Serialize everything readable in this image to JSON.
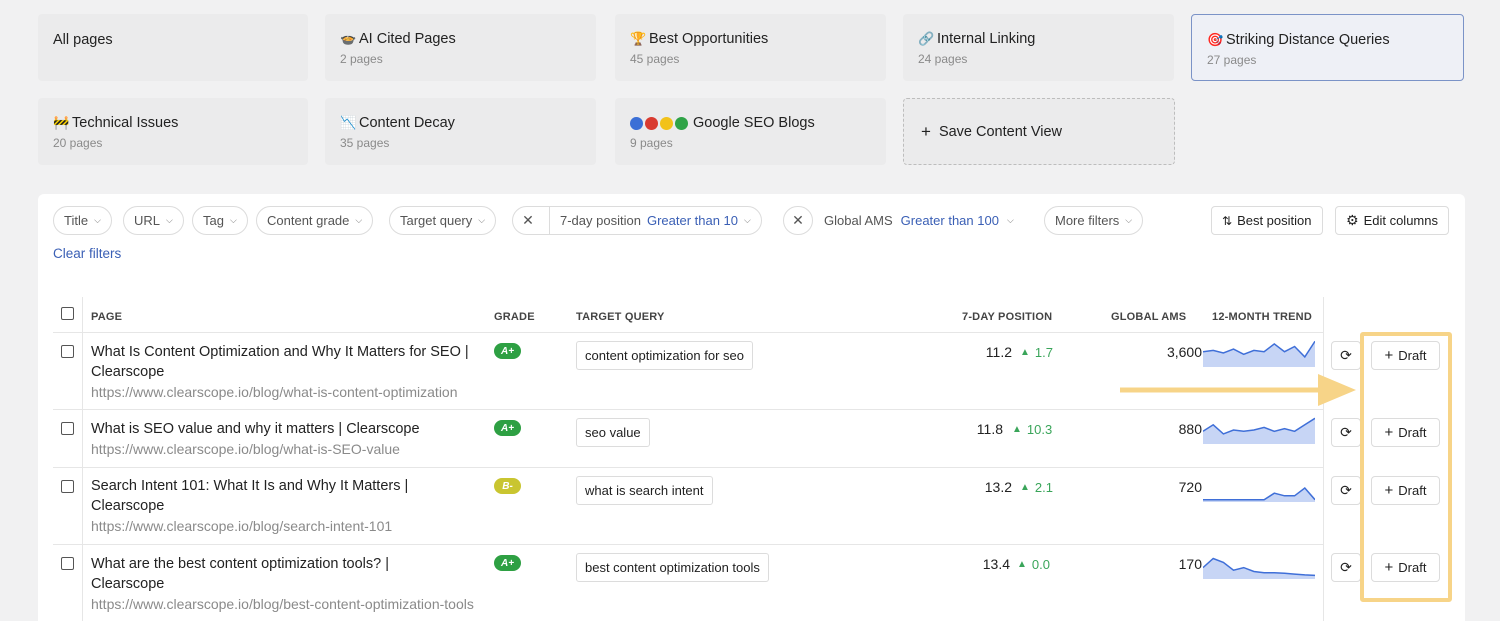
{
  "views": [
    {
      "name": "All pages",
      "count": "",
      "emoji": ""
    },
    {
      "name": "AI Cited Pages",
      "count": "2 pages",
      "emoji": "🍲"
    },
    {
      "name": "Best Opportunities",
      "count": "45 pages",
      "emoji": "🏆"
    },
    {
      "name": "Internal Linking",
      "count": "24 pages",
      "emoji": "🔗"
    },
    {
      "name": "Striking Distance Queries",
      "count": "27 pages",
      "emoji": "🎯"
    },
    {
      "name": "Technical Issues",
      "count": "20 pages",
      "emoji": "🚧"
    },
    {
      "name": "Content Decay",
      "count": "35 pages",
      "emoji": "📉"
    },
    {
      "name": "Google SEO Blogs",
      "count": "9 pages",
      "emoji": ""
    }
  ],
  "save_view_label": "Save Content View",
  "filters": {
    "title": "Title",
    "url": "URL",
    "tag": "Tag",
    "content_grade": "Content grade",
    "target_query": "Target query",
    "position_label": "7-day position",
    "position_value": "Greater than 10",
    "ams_label": "Global AMS",
    "ams_value": "Greater than 100",
    "more": "More filters",
    "clear": "Clear filters"
  },
  "actions": {
    "sort": "Best position",
    "edit_columns": "Edit columns"
  },
  "columns": {
    "page": "PAGE",
    "grade": "GRADE",
    "target_query": "TARGET QUERY",
    "position": "7-DAY POSITION",
    "ams": "GLOBAL AMS",
    "trend": "12-MONTH TREND"
  },
  "rows": [
    {
      "title": "What Is Content Optimization and Why It Matters for SEO | Clearscope",
      "url": "https://www.clearscope.io/blog/what-is-content-optimization",
      "grade": "A+",
      "grade_color": "#2ea043",
      "query": "content optimization for seo",
      "position": "11.2",
      "delta": "1.7",
      "ams": "3,600",
      "trend": [
        0.55,
        0.6,
        0.5,
        0.65,
        0.45,
        0.6,
        0.55,
        0.85,
        0.55,
        0.75,
        0.35,
        0.95
      ]
    },
    {
      "title": "What is SEO value and why it matters | Clearscope",
      "url": "https://www.clearscope.io/blog/what-is-SEO-value",
      "grade": "A+",
      "grade_color": "#2ea043",
      "query": "seo value",
      "position": "11.8",
      "delta": "10.3",
      "ams": "880",
      "trend": [
        0.45,
        0.7,
        0.35,
        0.5,
        0.45,
        0.5,
        0.6,
        0.45,
        0.55,
        0.45,
        0.7,
        0.95
      ]
    },
    {
      "title": "Search Intent 101: What It Is and Why It Matters | Clearscope",
      "url": "https://www.clearscope.io/blog/search-intent-101",
      "grade": "B-",
      "grade_color": "#c9c530",
      "query": "what is search intent",
      "position": "13.2",
      "delta": "2.1",
      "ams": "720",
      "trend": [
        0.05,
        0.05,
        0.05,
        0.05,
        0.05,
        0.05,
        0.05,
        0.3,
        0.2,
        0.2,
        0.5,
        0.05
      ]
    },
    {
      "title": "What are the best content optimization tools? | Clearscope",
      "url": "https://www.clearscope.io/blog/best-content-optimization-tools",
      "grade": "A+",
      "grade_color": "#2ea043",
      "query": "best content optimization tools",
      "position": "13.4",
      "delta": "0.0",
      "ams": "170",
      "trend": [
        0.4,
        0.75,
        0.6,
        0.3,
        0.4,
        0.25,
        0.2,
        0.2,
        0.18,
        0.15,
        0.12,
        0.1
      ]
    }
  ],
  "draft_label": "Draft",
  "colors": {
    "accent": "#3a5fb5",
    "positive": "#3aa55a",
    "spark_line": "#3f6fd8",
    "spark_fill": "#c7d5f5",
    "highlight": "#f7d488"
  }
}
